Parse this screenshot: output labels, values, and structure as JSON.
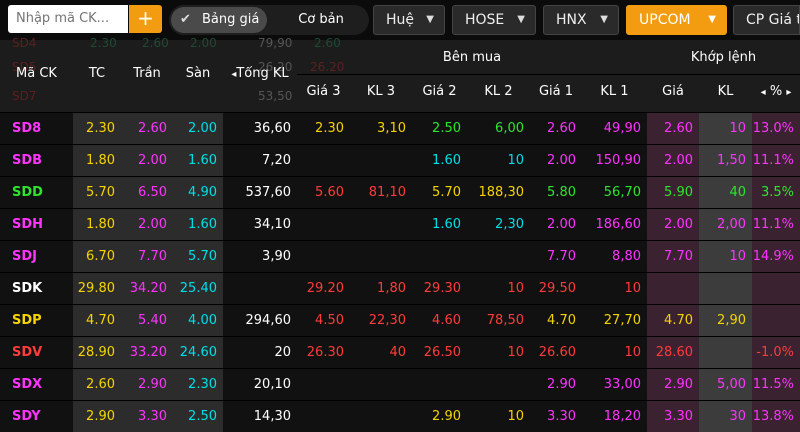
{
  "toolbar": {
    "search_placeholder": "Nhập mã CK...",
    "add_label": "+",
    "check_glyph": "✔",
    "view_active": "Bảng giá",
    "view_other": "Cơ bản",
    "tabs": [
      {
        "label": "Huệ",
        "active": false
      },
      {
        "label": "HOSE",
        "active": false
      },
      {
        "label": "HNX",
        "active": false
      },
      {
        "label": "UPCOM",
        "active": true
      },
      {
        "label": "CP Giá t",
        "active": false
      }
    ],
    "caret_glyph": "▼"
  },
  "ghost_rows": [
    {
      "symbol": "SD4",
      "tc": "2.30",
      "tran": "2.60",
      "san": "2.00",
      "total": "79,90",
      "gia3": "2.60"
    },
    {
      "symbol": "SD5",
      "tc": "",
      "tran": "",
      "san": "",
      "total": "26,20",
      "gia3": "26.20"
    },
    {
      "symbol": "SD7",
      "tc": "",
      "tran": "",
      "san": "",
      "total": "53,50",
      "gia3": ""
    }
  ],
  "header": {
    "ma_ck": "Mã CK",
    "tc": "TC",
    "tran": "Trần",
    "san": "Sàn",
    "tong_kl": "Tổng KL",
    "tong_kl_arrow": "◂",
    "ben_mua": "Bên mua",
    "gia3": "Giá 3",
    "kl3": "KL 3",
    "gia2": "Giá 2",
    "kl2": "KL 2",
    "gia1": "Giá 1",
    "kl1": "KL 1",
    "khop_lenh": "Khớp lệnh",
    "gia": "Giá",
    "kl": "KL",
    "pct": "%",
    "pct_left": "◂",
    "pct_right": "▸"
  },
  "rows": [
    {
      "symbol": "SD8",
      "symbol_color": "fuchsia",
      "tc": "2.30",
      "tran": "2.60",
      "san": "2.00",
      "total": "36,60",
      "gia3": "2.30",
      "gia3_c": "yellow",
      "kl3": "3,10",
      "kl3_c": "yellow",
      "gia2": "2.50",
      "gia2_c": "green",
      "kl2": "6,00",
      "kl2_c": "green",
      "gia1": "2.60",
      "gia1_c": "fuchsia",
      "kl1": "49,90",
      "kl1_c": "fuchsia",
      "gia": "2.60",
      "gia_c": "fuchsia",
      "kl": "10",
      "kl_c": "fuchsia",
      "pct": "13.0%",
      "pct_c": "fuchsia"
    },
    {
      "symbol": "SDB",
      "symbol_color": "fuchsia",
      "tc": "1.80",
      "tran": "2.00",
      "san": "1.60",
      "total": "7,20",
      "gia3": "",
      "gia3_c": "white",
      "kl3": "",
      "kl3_c": "white",
      "gia2": "1.60",
      "gia2_c": "cyan",
      "kl2": "10",
      "kl2_c": "cyan",
      "gia1": "2.00",
      "gia1_c": "fuchsia",
      "kl1": "150,90",
      "kl1_c": "fuchsia",
      "gia": "2.00",
      "gia_c": "fuchsia",
      "kl": "1,50",
      "kl_c": "fuchsia",
      "pct": "11.1%",
      "pct_c": "fuchsia"
    },
    {
      "symbol": "SDD",
      "symbol_color": "green",
      "tc": "5.70",
      "tran": "6.50",
      "san": "4.90",
      "total": "537,60",
      "gia3": "5.60",
      "gia3_c": "red",
      "kl3": "81,10",
      "kl3_c": "red",
      "gia2": "5.70",
      "gia2_c": "yellow",
      "kl2": "188,30",
      "kl2_c": "yellow",
      "gia1": "5.80",
      "gia1_c": "green",
      "kl1": "56,70",
      "kl1_c": "green",
      "gia": "5.90",
      "gia_c": "green",
      "kl": "40",
      "kl_c": "green",
      "pct": "3.5%",
      "pct_c": "green"
    },
    {
      "symbol": "SDH",
      "symbol_color": "fuchsia",
      "tc": "1.80",
      "tran": "2.00",
      "san": "1.60",
      "total": "34,10",
      "gia3": "",
      "gia3_c": "white",
      "kl3": "",
      "kl3_c": "white",
      "gia2": "1.60",
      "gia2_c": "cyan",
      "kl2": "2,30",
      "kl2_c": "cyan",
      "gia1": "2.00",
      "gia1_c": "fuchsia",
      "kl1": "186,60",
      "kl1_c": "fuchsia",
      "gia": "2.00",
      "gia_c": "fuchsia",
      "kl": "2,00",
      "kl_c": "fuchsia",
      "pct": "11.1%",
      "pct_c": "fuchsia"
    },
    {
      "symbol": "SDJ",
      "symbol_color": "fuchsia",
      "tc": "6.70",
      "tran": "7.70",
      "san": "5.70",
      "total": "3,90",
      "gia3": "",
      "gia3_c": "white",
      "kl3": "",
      "kl3_c": "white",
      "gia2": "",
      "gia2_c": "white",
      "kl2": "",
      "kl2_c": "white",
      "gia1": "7.70",
      "gia1_c": "fuchsia",
      "kl1": "8,80",
      "kl1_c": "fuchsia",
      "gia": "7.70",
      "gia_c": "fuchsia",
      "kl": "10",
      "kl_c": "fuchsia",
      "pct": "14.9%",
      "pct_c": "fuchsia"
    },
    {
      "symbol": "SDK",
      "symbol_color": "white",
      "tc": "29.80",
      "tran": "34.20",
      "san": "25.40",
      "total": "",
      "gia3": "29.20",
      "gia3_c": "red",
      "kl3": "1,80",
      "kl3_c": "red",
      "gia2": "29.30",
      "gia2_c": "red",
      "kl2": "10",
      "kl2_c": "red",
      "gia1": "29.50",
      "gia1_c": "red",
      "kl1": "10",
      "kl1_c": "red",
      "gia": "",
      "gia_c": "white",
      "kl": "",
      "kl_c": "white",
      "pct": "",
      "pct_c": "white"
    },
    {
      "symbol": "SDP",
      "symbol_color": "yellow",
      "tc": "4.70",
      "tran": "5.40",
      "san": "4.00",
      "total": "294,60",
      "gia3": "4.50",
      "gia3_c": "red",
      "kl3": "22,30",
      "kl3_c": "red",
      "gia2": "4.60",
      "gia2_c": "red",
      "kl2": "78,50",
      "kl2_c": "red",
      "gia1": "4.70",
      "gia1_c": "yellow",
      "kl1": "27,70",
      "kl1_c": "yellow",
      "gia": "4.70",
      "gia_c": "yellow",
      "kl": "2,90",
      "kl_c": "yellow",
      "pct": "",
      "pct_c": "yellow"
    },
    {
      "symbol": "SDV",
      "symbol_color": "red",
      "tc": "28.90",
      "tran": "33.20",
      "san": "24.60",
      "total": "20",
      "gia3": "26.30",
      "gia3_c": "red",
      "kl3": "40",
      "kl3_c": "red",
      "gia2": "26.50",
      "gia2_c": "red",
      "kl2": "10",
      "kl2_c": "red",
      "gia1": "26.60",
      "gia1_c": "red",
      "kl1": "10",
      "kl1_c": "red",
      "gia": "28.60",
      "gia_c": "red",
      "kl": "",
      "kl_c": "red",
      "pct": "-1.0%",
      "pct_c": "red"
    },
    {
      "symbol": "SDX",
      "symbol_color": "fuchsia",
      "tc": "2.60",
      "tran": "2.90",
      "san": "2.30",
      "total": "20,10",
      "gia3": "",
      "gia3_c": "white",
      "kl3": "",
      "kl3_c": "white",
      "gia2": "",
      "gia2_c": "white",
      "kl2": "",
      "kl2_c": "white",
      "gia1": "2.90",
      "gia1_c": "fuchsia",
      "kl1": "33,00",
      "kl1_c": "fuchsia",
      "gia": "2.90",
      "gia_c": "fuchsia",
      "kl": "5,00",
      "kl_c": "fuchsia",
      "pct": "11.5%",
      "pct_c": "fuchsia"
    },
    {
      "symbol": "SDY",
      "symbol_color": "fuchsia",
      "tc": "2.90",
      "tran": "3.30",
      "san": "2.50",
      "total": "14,30",
      "gia3": "",
      "gia3_c": "white",
      "kl3": "",
      "kl3_c": "white",
      "gia2": "2.90",
      "gia2_c": "yellow",
      "kl2": "10",
      "kl2_c": "yellow",
      "gia1": "3.30",
      "gia1_c": "fuchsia",
      "kl1": "18,20",
      "kl1_c": "fuchsia",
      "gia": "3.30",
      "gia_c": "fuchsia",
      "kl": "30",
      "kl_c": "fuchsia",
      "pct": "13.8%",
      "pct_c": "fuchsia"
    }
  ]
}
